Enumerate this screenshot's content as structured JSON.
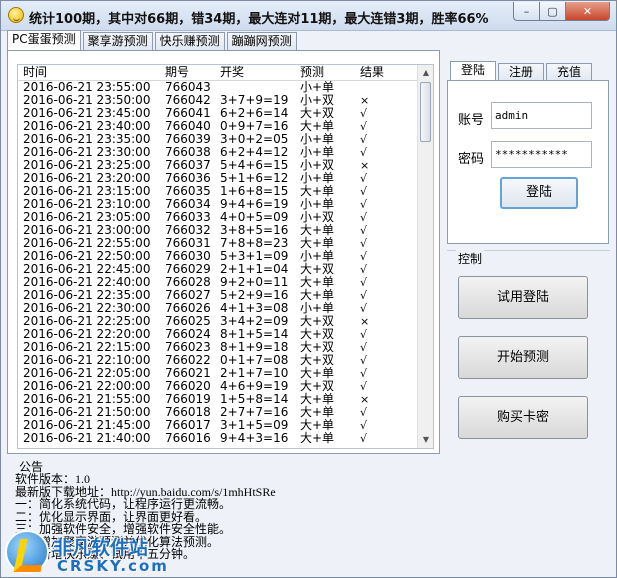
{
  "window": {
    "title": "统计100期，其中对66期，错34期，最大连对11期，最大连错3期，胜率66%",
    "buttons": {
      "minimize": "–",
      "maximize": "▢",
      "close": "✕"
    }
  },
  "tabs": [
    {
      "label": "PC蛋蛋预测"
    },
    {
      "label": "聚享游预测"
    },
    {
      "label": "快乐赚预测"
    },
    {
      "label": "蹦蹦网预测"
    }
  ],
  "grid": {
    "columns": [
      "时间",
      "期号",
      "开奖",
      "预测",
      "结果"
    ],
    "rows": [
      [
        "2016-06-21 23:55:00",
        "766043",
        "",
        "小+单",
        ""
      ],
      [
        "2016-06-21 23:50:00",
        "766042",
        "3+7+9=19",
        "小+双",
        "×"
      ],
      [
        "2016-06-21 23:45:00",
        "766041",
        "6+2+6=14",
        "大+双",
        "√"
      ],
      [
        "2016-06-21 23:40:00",
        "766040",
        "0+9+7=16",
        "大+单",
        "√"
      ],
      [
        "2016-06-21 23:35:00",
        "766039",
        "3+0+2=05",
        "小+单",
        "√"
      ],
      [
        "2016-06-21 23:30:00",
        "766038",
        "6+2+4=12",
        "小+单",
        "√"
      ],
      [
        "2016-06-21 23:25:00",
        "766037",
        "5+4+6=15",
        "小+双",
        "×"
      ],
      [
        "2016-06-21 23:20:00",
        "766036",
        "5+1+6=12",
        "小+单",
        "√"
      ],
      [
        "2016-06-21 23:15:00",
        "766035",
        "1+6+8=15",
        "大+单",
        "√"
      ],
      [
        "2016-06-21 23:10:00",
        "766034",
        "9+4+6=19",
        "小+单",
        "√"
      ],
      [
        "2016-06-21 23:05:00",
        "766033",
        "4+0+5=09",
        "小+双",
        "√"
      ],
      [
        "2016-06-21 23:00:00",
        "766032",
        "3+8+5=16",
        "大+单",
        "√"
      ],
      [
        "2016-06-21 22:55:00",
        "766031",
        "7+8+8=23",
        "大+单",
        "√"
      ],
      [
        "2016-06-21 22:50:00",
        "766030",
        "5+3+1=09",
        "小+单",
        "√"
      ],
      [
        "2016-06-21 22:45:00",
        "766029",
        "2+1+1=04",
        "大+双",
        "√"
      ],
      [
        "2016-06-21 22:40:00",
        "766028",
        "9+2+0=11",
        "大+单",
        "√"
      ],
      [
        "2016-06-21 22:35:00",
        "766027",
        "5+2+9=16",
        "大+单",
        "√"
      ],
      [
        "2016-06-21 22:30:00",
        "766026",
        "4+1+3=08",
        "小+单",
        "√"
      ],
      [
        "2016-06-21 22:25:00",
        "766025",
        "3+4+2=09",
        "大+双",
        "×"
      ],
      [
        "2016-06-21 22:20:00",
        "766024",
        "8+1+5=14",
        "大+双",
        "√"
      ],
      [
        "2016-06-21 22:15:00",
        "766023",
        "8+1+9=18",
        "大+双",
        "√"
      ],
      [
        "2016-06-21 22:10:00",
        "766022",
        "0+1+7=08",
        "大+双",
        "√"
      ],
      [
        "2016-06-21 22:05:00",
        "766021",
        "2+1+7=10",
        "大+单",
        "√"
      ],
      [
        "2016-06-21 22:00:00",
        "766020",
        "4+6+9=19",
        "大+双",
        "√"
      ],
      [
        "2016-06-21 21:55:00",
        "766019",
        "1+5+8=14",
        "大+单",
        "×"
      ],
      [
        "2016-06-21 21:50:00",
        "766018",
        "2+7+7=16",
        "大+单",
        "√"
      ],
      [
        "2016-06-21 21:45:00",
        "766017",
        "3+1+5=09",
        "大+单",
        "√"
      ],
      [
        "2016-06-21 21:40:00",
        "766016",
        "9+4+3=16",
        "大+单",
        "√"
      ]
    ]
  },
  "login": {
    "tabs": [
      "登陆",
      "注册",
      "充值"
    ],
    "account_label": "账号",
    "account_value": "admin",
    "password_label": "密码",
    "password_value": "***********",
    "login_button": "登陆"
  },
  "control": {
    "title": "控制",
    "buttons": [
      "试用登陆",
      "开始预测",
      "购买卡密"
    ]
  },
  "notice": {
    "label": "公告",
    "lines": [
      "软件版本：1.0",
      "最新版下载地址：http://yun.baidu.com/s/1mhHtSRe",
      "一：简化系统代码，让程序运行更流畅。",
      "二：优化显示界面，让界面更好看。",
      "三：加强软件安全，增强软件安全性能。",
      "四：增加聚享游预测并优化算法预测。",
      "五：新增快乐赚、试用十五分钟。"
    ]
  },
  "watermark": {
    "cn": "非凡软件站",
    "en": "CRSKY.com"
  }
}
